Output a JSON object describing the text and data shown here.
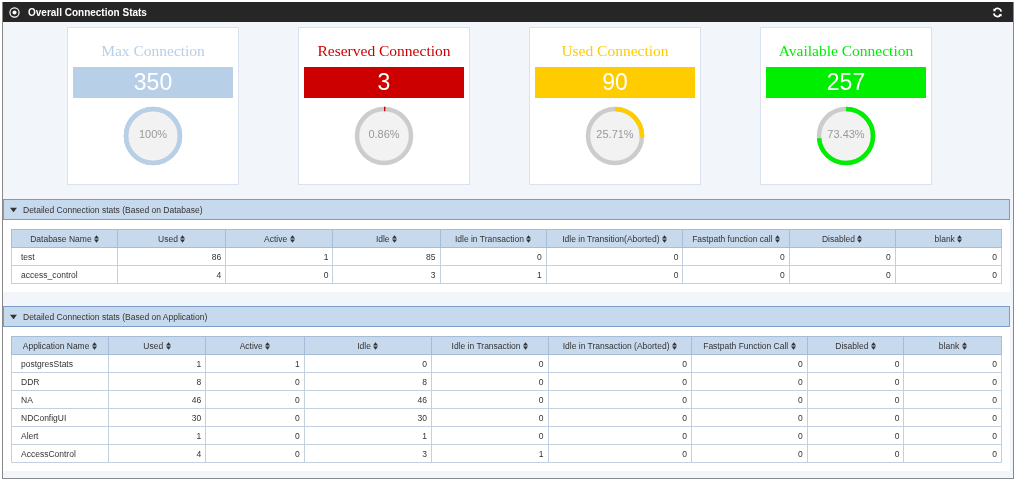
{
  "window": {
    "title": "Overall Connection Stats"
  },
  "cards": [
    {
      "title": "Max Connection",
      "value": "350",
      "percent": "100%",
      "level": 1,
      "color": "#b8cfe8"
    },
    {
      "title": "Reserved Connection",
      "value": "3",
      "percent": "0.86%",
      "level": 0.0086,
      "color": "#cc0000"
    },
    {
      "title": "Used Connection",
      "value": "90",
      "percent": "25.71%",
      "level": 0.2571,
      "color": "#ffcc00"
    },
    {
      "title": "Available Connection",
      "value": "257",
      "percent": "73.43%",
      "level": 0.7343,
      "color": "#00ee00"
    }
  ],
  "sections": [
    {
      "title": "Detailed Connection stats (Based on Database)",
      "expanded": true,
      "columns": [
        "Database Name",
        "Used",
        "Active",
        "Idle",
        "Idle in Transaction",
        "Idle in Transition(Aborted)",
        "Fastpath function call",
        "Disabled",
        "blank"
      ],
      "rows": [
        [
          "test",
          "86",
          "1",
          "85",
          "0",
          "0",
          "0",
          "0",
          "0"
        ],
        [
          "access_control",
          "4",
          "0",
          "3",
          "1",
          "0",
          "0",
          "0",
          "0"
        ]
      ]
    },
    {
      "title": "Detailed Connection stats (Based on Application)",
      "expanded": true,
      "columns": [
        "Application Name",
        "Used",
        "Active",
        "Idle",
        "Idle in Transaction",
        "Idle in Transaction (Aborted)",
        "Fastpath Function Call",
        "Disabled",
        "blank"
      ],
      "rows": [
        [
          "postgresStats",
          "1",
          "1",
          "0",
          "0",
          "0",
          "0",
          "0",
          "0"
        ],
        [
          "DDR",
          "8",
          "0",
          "8",
          "0",
          "0",
          "0",
          "0",
          "0"
        ],
        [
          "NA",
          "46",
          "0",
          "46",
          "0",
          "0",
          "0",
          "0",
          "0"
        ],
        [
          "NDConfigUI",
          "30",
          "0",
          "30",
          "0",
          "0",
          "0",
          "0",
          "0"
        ],
        [
          "Alert",
          "1",
          "0",
          "1",
          "0",
          "0",
          "0",
          "0",
          "0"
        ],
        [
          "AccessControl",
          "4",
          "0",
          "3",
          "1",
          "0",
          "0",
          "0",
          "0"
        ]
      ]
    }
  ]
}
